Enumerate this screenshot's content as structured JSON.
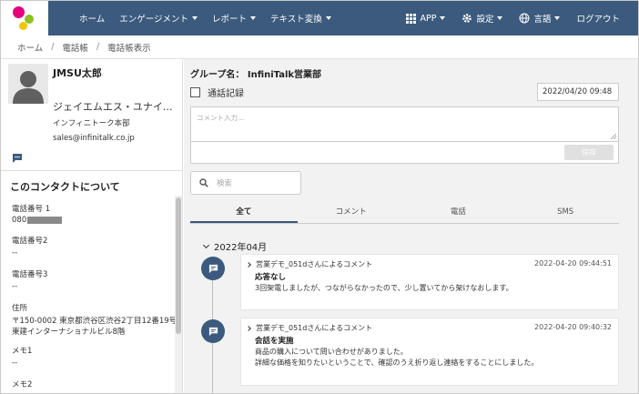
{
  "nav": {
    "items": [
      "ホーム",
      "エンゲージメント",
      "レポート",
      "テキスト変換"
    ],
    "app": "APP",
    "settings": "設定",
    "language": "言語",
    "logout": "ログアウト"
  },
  "breadcrumb": [
    "ホーム",
    "電話帳",
    "電話帳表示"
  ],
  "contact": {
    "name": "JMSU太郎",
    "company": "ジェイエムエス・ユナイテッド",
    "department": "インフィニトーク本部",
    "email": "sales@infinitalk.co.jp",
    "about_heading": "このコンタクトについて",
    "fields": [
      {
        "label": "電話番号 1",
        "value": "080"
      },
      {
        "label": "電話番号2",
        "value": "--"
      },
      {
        "label": "電話番号3",
        "value": "--"
      },
      {
        "label": "住所",
        "value": "〒150-0002 東京都渋谷区渋谷2丁目12番19号",
        "value2": "東建インターナショナルビル8階"
      },
      {
        "label": "メモ1",
        "value": "--"
      },
      {
        "label": "メモ2",
        "value": ""
      }
    ]
  },
  "main": {
    "group_title": "グループ名： InfiniTalk営業部",
    "call_record_label": "通話記録",
    "datetime": "2022/04/20 09:48",
    "comment_placeholder": "コメント入力...",
    "save_label": "保存",
    "search_placeholder": "検索",
    "tabs": [
      "全て",
      "コメント",
      "電話",
      "SMS"
    ],
    "month": "2022年04月",
    "entries": [
      {
        "header": "営業デモ_051dさんによるコメント",
        "time": "2022-04-20 09:44:51",
        "title": "応答なし",
        "lines": [
          "3回架電しましたが、つながらなかったので、少し置いてから架けなおします。"
        ]
      },
      {
        "header": "営業デモ_051dさんによるコメント",
        "time": "2022-04-20 09:40:32",
        "title": "会話を実施",
        "lines": [
          "商品の購入について問い合わせがありました。",
          "詳細な価格を知りたいということで、確認のうえ折り返し連絡をすることにしました。"
        ]
      }
    ]
  },
  "colors": {
    "nav_bg": "#3b5a7d",
    "accent": "#3b5a7d",
    "logo_pink": "#e6007e",
    "logo_green": "#8dc21f",
    "logo_yellow": "#f2c500"
  }
}
